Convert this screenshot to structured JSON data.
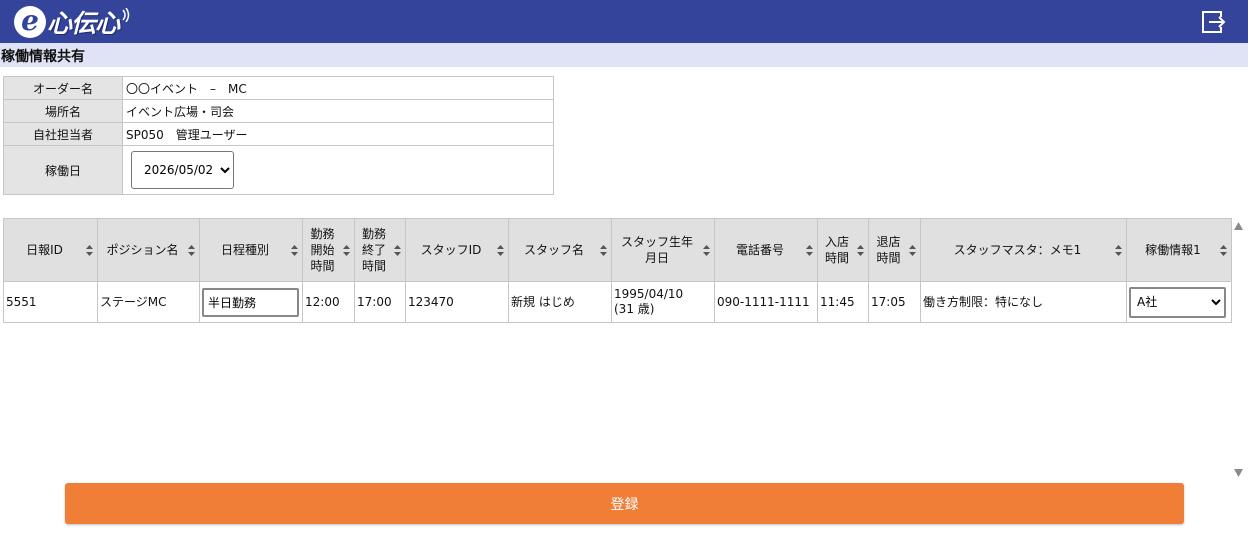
{
  "app": {
    "logo_text": "心伝心",
    "logo_e": "e",
    "brand_color": "#34449b",
    "logout_icon": "logout-icon"
  },
  "page": {
    "title": "稼働情報共有"
  },
  "info": {
    "order_label": "オーダー名",
    "order_value": "〇〇イベント　–　MC",
    "place_label": "場所名",
    "place_value": "イベント広場・司会",
    "rep_label": "自社担当者",
    "rep_value": "SP050　管理ユーザー",
    "date_label": "稼働日",
    "date_value": "2026/05/02"
  },
  "grid": {
    "headers": {
      "report_id": "日報ID",
      "position": "ポジション名",
      "schedule_type": "日程種別",
      "start_time": [
        "勤務",
        "開始",
        "時間"
      ],
      "end_time": [
        "勤務",
        "終了",
        "時間"
      ],
      "staff_id": "スタッフID",
      "staff_name": "スタッフ名",
      "birthday": [
        "スタッフ生年",
        "月日"
      ],
      "phone": "電話番号",
      "checkin": [
        "入店",
        "時間"
      ],
      "checkout": [
        "退店",
        "時間"
      ],
      "memo": "スタッフマスタ：メモ1",
      "work_info": "稼働情報1"
    },
    "row": {
      "report_id": "5551",
      "position": "ステージMC",
      "schedule_type": "半日勤務",
      "start_time": "12:00",
      "end_time": "17:00",
      "staff_id": "123470",
      "staff_name": "新規 はじめ",
      "birthday": "1995/04/10",
      "age": "(31 歳)",
      "phone": "090-1111-1111",
      "checkin": "11:45",
      "checkout": "17:05",
      "memo": "働き方制限：特になし",
      "work_info": "A社"
    }
  },
  "actions": {
    "register_label": "登録",
    "register_color": "#f07e37"
  }
}
